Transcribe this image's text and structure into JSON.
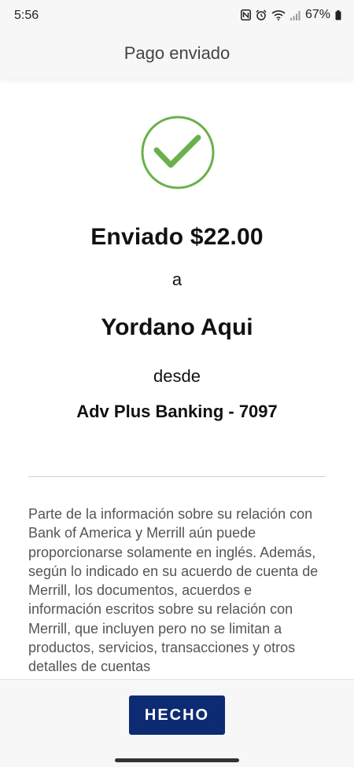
{
  "status_bar": {
    "time": "5:56",
    "battery": "67%",
    "icons": [
      "nfc-icon",
      "alarm-icon",
      "wifi-icon",
      "signal-icon",
      "battery-icon"
    ]
  },
  "header": {
    "title": "Pago enviado"
  },
  "confirmation": {
    "icon": "check-circle-icon",
    "amount_text": "Enviado $22.00",
    "to_word": "a",
    "recipient": "Yordano Aqui",
    "from_word": "desde",
    "account": "Adv Plus Banking - 7097"
  },
  "disclaimer": "Parte de la información sobre su relación con Bank of America y Merrill aún puede proporcionarse solamente en inglés. Además, según lo indicado en su acuerdo de cuenta de Merrill, los documentos, acuerdos e información escritos sobre su relación con Merrill, que incluyen pero no se limitan a productos, servicios, transacciones y otros detalles de cuentas",
  "footer": {
    "done_label": "HECHO"
  },
  "colors": {
    "accent": "#0d2b73",
    "success": "#6ab04c"
  }
}
